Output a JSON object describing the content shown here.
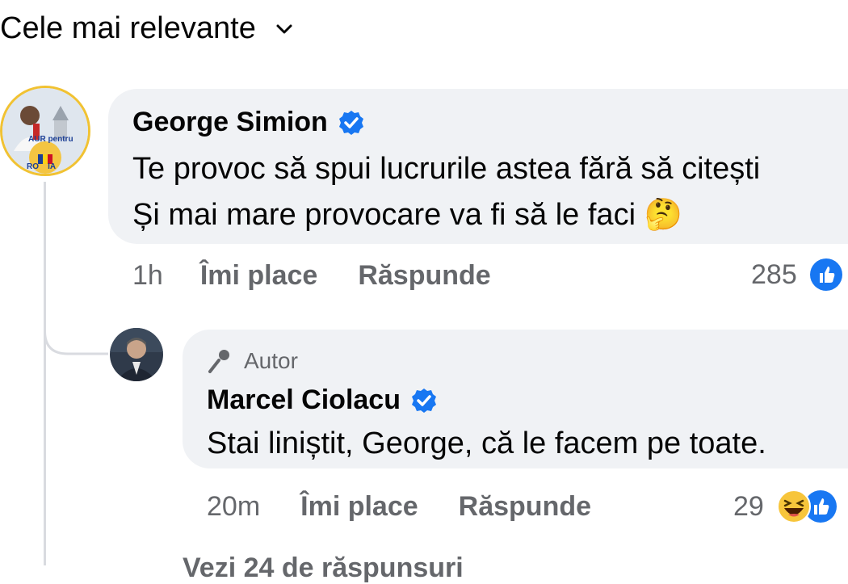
{
  "sort": {
    "label": "Cele mai relevante"
  },
  "comment": {
    "author": "George Simion",
    "avatar_text_top": "AUR pentru",
    "avatar_text_bottom": "RO    IA",
    "line1": "Te provoc să spui lucrurile astea fără să citești",
    "line2": "Și mai mare provocare va fi să le faci 🤔",
    "time": "1h",
    "like": "Îmi place",
    "reply": "Răspunde",
    "reactions_count": "285"
  },
  "reply": {
    "tag": "Autor",
    "author": "Marcel Ciolacu",
    "text": "Stai liniștit, George, că le facem pe toate.",
    "time": "20m",
    "like": "Îmi place",
    "reply": "Răspunde",
    "reactions_count": "29"
  },
  "more_replies": {
    "label": "Vezi 24 de răspunsuri"
  },
  "colors": {
    "accent": "#1877f2",
    "bubble": "#f0f2f5",
    "muted": "#65676b"
  }
}
